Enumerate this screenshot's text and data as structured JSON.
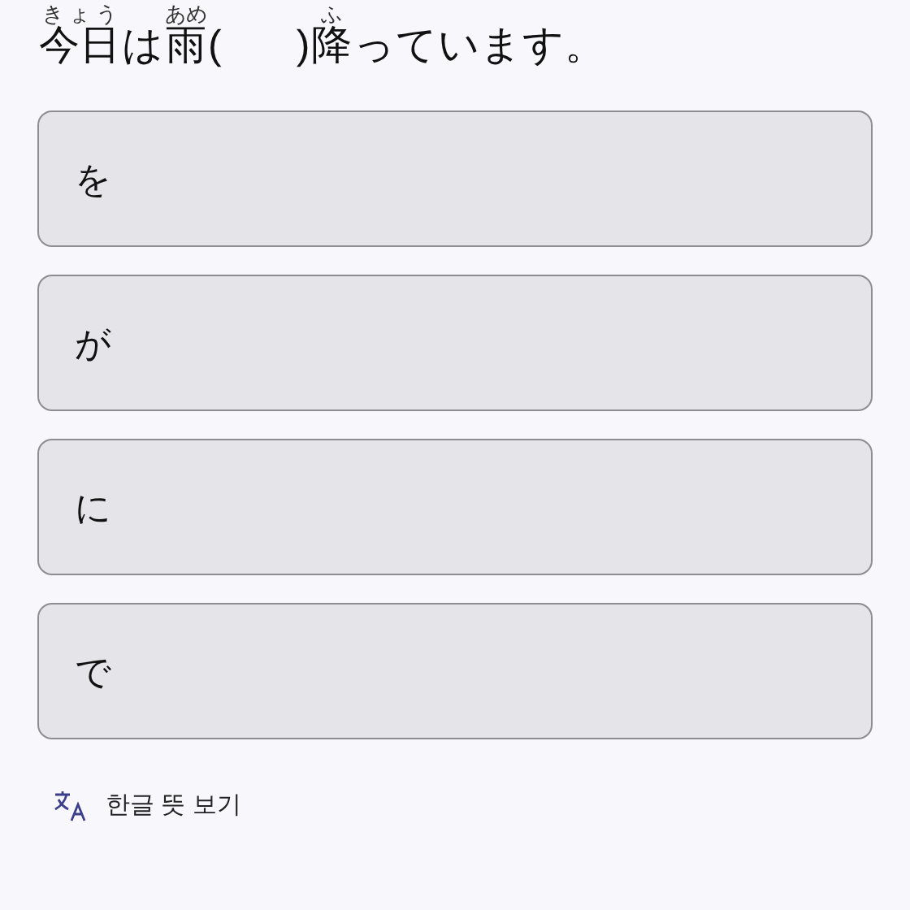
{
  "question": {
    "segments": [
      {
        "kind": "ruby",
        "text": "今日",
        "ruby": "きょう"
      },
      {
        "kind": "plain",
        "text": "は"
      },
      {
        "kind": "ruby",
        "text": "雨",
        "ruby": "あめ"
      },
      {
        "kind": "plain",
        "text": "("
      },
      {
        "kind": "blank"
      },
      {
        "kind": "plain",
        "text": ")"
      },
      {
        "kind": "ruby",
        "text": "降",
        "ruby": "ふ"
      },
      {
        "kind": "plain",
        "text": "っています。"
      }
    ]
  },
  "options": [
    {
      "label": "を",
      "selected": false
    },
    {
      "label": "が",
      "selected": false
    },
    {
      "label": "に",
      "selected": false
    },
    {
      "label": "で",
      "selected": false
    }
  ],
  "translation_toggle": {
    "label": "한글 뜻 보기"
  }
}
